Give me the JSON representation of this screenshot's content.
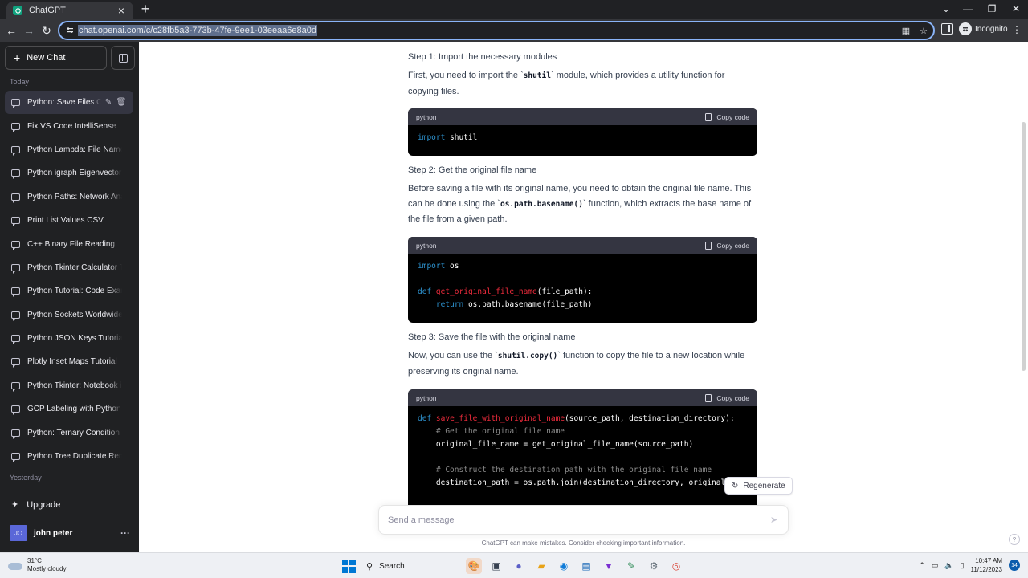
{
  "browser": {
    "tab_title": "ChatGPT",
    "url": "chat.openai.com/c/c28fb5a3-773b-47fe-9ee1-03eeaa6e8a0d",
    "profile_label": "Incognito"
  },
  "sidebar": {
    "new_chat_label": "New Chat",
    "today_label": "Today",
    "yesterday_label": "Yesterday",
    "chats": [
      {
        "label": "Python: Save Files Ori"
      },
      {
        "label": "Fix VS Code IntelliSense"
      },
      {
        "label": "Python Lambda: File Name"
      },
      {
        "label": "Python igraph Eigenvector Tu"
      },
      {
        "label": "Python Paths: Network Analy"
      },
      {
        "label": "Print List Values CSV"
      },
      {
        "label": "C++ Binary File Reading"
      },
      {
        "label": "Python Tkinter Calculator Tu"
      },
      {
        "label": "Python Tutorial: Code Examp"
      },
      {
        "label": "Python Sockets Worldwide T"
      },
      {
        "label": "Python JSON Keys Tutorial"
      },
      {
        "label": "Plotly Inset Maps Tutorial"
      },
      {
        "label": "Python Tkinter: Notebook in"
      },
      {
        "label": "GCP Labeling with Python"
      },
      {
        "label": "Python: Ternary Condition Tu"
      },
      {
        "label": "Python Tree Duplicate Remo"
      }
    ],
    "upgrade_label": "Upgrade",
    "user_initials": "JO",
    "user_name": "john peter"
  },
  "conversation": {
    "step1_title": "Step 1: Import the necessary modules",
    "step1_text_a": "First, you need to import the `",
    "step1_code": "shutil",
    "step1_text_b": "` module, which provides a utility function for copying files.",
    "step2_title": "Step 2: Get the original file name",
    "step2_text_a": "Before saving a file with its original name, you need to obtain the original file name. This can be done using the `",
    "step2_code": "os.path.basename()",
    "step2_text_b": "` function, which extracts the base name of the file from a given path.",
    "step3_title": "Step 3: Save the file with the original name",
    "step3_text_a": "Now, you can use the `",
    "step3_code": "shutil.copy()",
    "step3_text_b": "` function to copy the file to a new location while preserving its original name.",
    "code_lang": "python",
    "copy_label": "Copy code",
    "code1": {
      "kw": "import",
      "rest": " shutil"
    },
    "code2": {
      "l1_kw": "import",
      "l1_rest": " os",
      "l3_kw": "def",
      "l3_fn": "get_original_file_name",
      "l3_rest": "(file_path):",
      "l4_indent": "    ",
      "l4_kw": "return",
      "l4_rest": " os.path.basename(file_path)"
    },
    "code3": {
      "l1_kw": "def",
      "l1_fn": "save_file_with_original_name",
      "l1_rest": "(source_path, destination_directory):",
      "l2": "    # Get the original file name",
      "l3": "    original_file_name = get_original_file_name(source_path)",
      "l5": "    # Construct the destination path with the original file name",
      "l6": "    destination_path = os.path.join(destination_directory, original_f"
    },
    "regenerate_label": "Regenerate",
    "input_placeholder": "Send a message",
    "disclaimer": "ChatGPT can make mistakes. Consider checking important information.",
    "help_label": "?"
  },
  "taskbar": {
    "temp": "31°C",
    "weather": "Mostly cloudy",
    "search_label": "Search",
    "time": "10:47 AM",
    "date": "11/12/2023",
    "notification_count": "14"
  },
  "colors": {
    "sidebar_bg": "#202123",
    "code_bg": "#000000",
    "code_keyword": "#2e95d3",
    "code_function": "#f22c3d",
    "code_comment": "#8a8a8a",
    "omnibox_focus": "#8ab4f8"
  }
}
